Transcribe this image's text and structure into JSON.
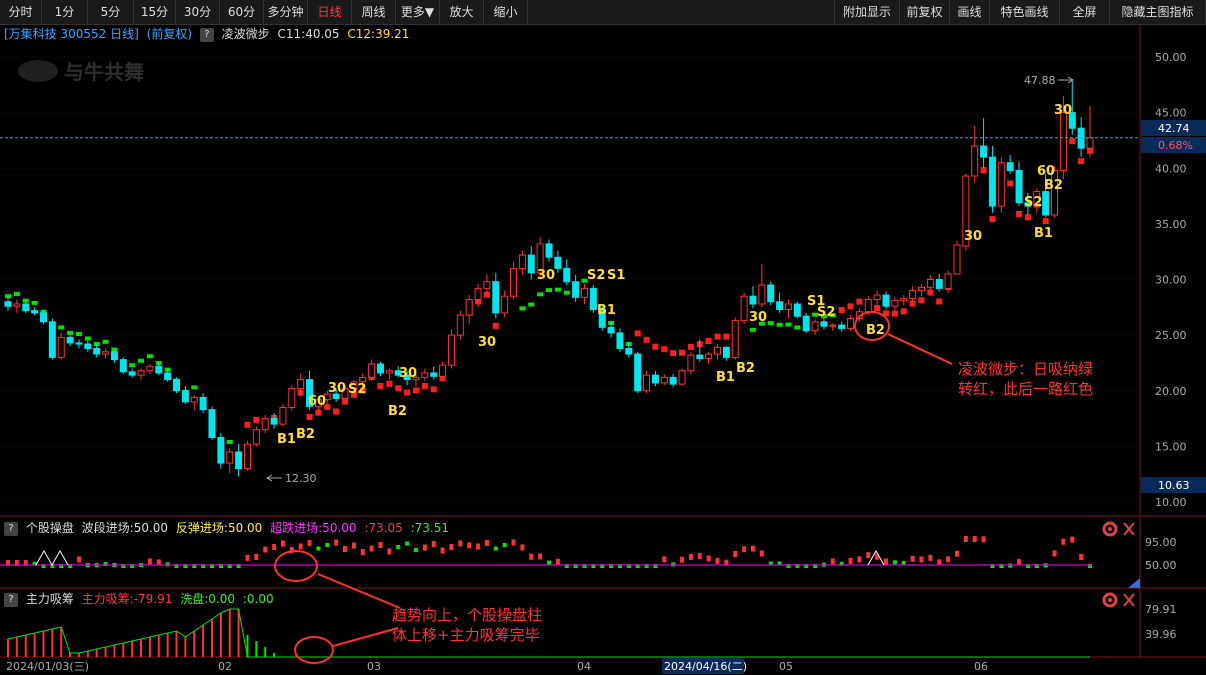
{
  "toolbar": {
    "left": [
      "分时",
      "1分",
      "5分",
      "15分",
      "30分",
      "60分",
      "多分钟",
      "日线",
      "周线",
      "更多▼",
      "放大",
      "缩小"
    ],
    "active": "日线",
    "right": [
      "附加显示",
      "前复权",
      "画线",
      "特色画线",
      "全屏",
      "隐藏主图指标"
    ]
  },
  "stock": {
    "title": "[万集科技 300552 日线]",
    "adjust": "(前复权)",
    "indicator": "凌波微步",
    "c1": "C11:40.05",
    "c2": "C12:39.21"
  },
  "watermark": "与牛共舞",
  "price_axis": {
    "labels": [
      "50.00",
      "45.00",
      "40.00",
      "35.00",
      "30.00",
      "25.00",
      "20.00",
      "15.00",
      "10.00"
    ],
    "current_price": "42.74",
    "change_pct": "0.68%",
    "bottom_price": "10.63"
  },
  "marks": {
    "high": "47.88",
    "low": "12.30"
  },
  "signal_labels": {
    "s30": "30",
    "s60": "60",
    "b1": "B1",
    "b2": "B2",
    "s1": "S1",
    "s2": "S2"
  },
  "annotations": {
    "main": [
      "凌波微步：日吸纳绿",
      "转红，此后一路红色"
    ],
    "sub": [
      "趋势向上，个股操盘柱",
      "体上移+主力吸筹完毕"
    ]
  },
  "panel1": {
    "name": "个股操盘",
    "p1": "波段进场:50.00",
    "p2": "反弹进场:50.00",
    "p3": "超跌进场:50.00",
    "p4": ":73.05",
    "p5": ":73.51",
    "axis": [
      "95.00",
      "50.00"
    ]
  },
  "panel2": {
    "name": "主力吸筹",
    "p1": "主力吸筹:-79.91",
    "p2": "洗盘:0.00",
    "p3": ":0.00",
    "axis": [
      "79.91",
      "39.96"
    ]
  },
  "date_axis": {
    "start": "2024/01/03(三)",
    "months": [
      "02",
      "03",
      "04",
      "05",
      "06"
    ],
    "cursor": "2024/04/16(二)"
  },
  "colors": {
    "up": "#ff3232",
    "down": "#00e5ee",
    "signal_text": "#ffdd33",
    "band_green": "#00e400",
    "band_red": "#ff1e1e",
    "annotation": "#ff3333"
  },
  "chart_data": {
    "type": "candlestick",
    "ylim": [
      9,
      52
    ],
    "current_price": 42.74,
    "candles_ohlc_approx": [
      [
        28.0,
        28.5,
        27.2,
        27.6
      ],
      [
        27.6,
        28.2,
        27.0,
        27.8
      ],
      [
        27.8,
        28.0,
        27.0,
        27.2
      ],
      [
        27.2,
        27.5,
        26.8,
        27.0
      ],
      [
        27.0,
        27.3,
        26.0,
        26.2
      ],
      [
        26.2,
        26.5,
        22.8,
        23.0
      ],
      [
        23.0,
        25.2,
        22.8,
        24.8
      ],
      [
        24.8,
        25.0,
        24.0,
        24.3
      ],
      [
        24.3,
        24.6,
        23.8,
        24.2
      ],
      [
        24.2,
        24.5,
        23.5,
        23.8
      ],
      [
        23.8,
        24.2,
        23.0,
        23.3
      ],
      [
        23.3,
        23.8,
        22.9,
        23.5
      ],
      [
        23.5,
        23.6,
        22.5,
        22.8
      ],
      [
        22.8,
        23.0,
        21.5,
        21.7
      ],
      [
        21.7,
        22.0,
        21.2,
        21.4
      ],
      [
        21.4,
        22.0,
        21.0,
        21.8
      ],
      [
        21.8,
        22.4,
        21.5,
        22.2
      ],
      [
        22.2,
        22.5,
        21.4,
        21.6
      ],
      [
        21.6,
        21.8,
        20.8,
        21.0
      ],
      [
        21.0,
        21.2,
        19.8,
        20.0
      ],
      [
        20.0,
        20.4,
        18.8,
        19.0
      ],
      [
        19.0,
        19.6,
        18.2,
        19.4
      ],
      [
        19.4,
        19.8,
        18.0,
        18.3
      ],
      [
        18.3,
        18.6,
        15.6,
        15.8
      ],
      [
        15.8,
        16.2,
        13.0,
        13.5
      ],
      [
        13.5,
        14.8,
        12.6,
        14.5
      ],
      [
        14.5,
        15.2,
        12.3,
        13.0
      ],
      [
        13.0,
        15.5,
        12.8,
        15.2
      ],
      [
        15.2,
        16.8,
        15.0,
        16.5
      ],
      [
        16.5,
        17.8,
        16.2,
        17.5
      ],
      [
        17.5,
        18.0,
        16.6,
        17.0
      ],
      [
        17.0,
        18.8,
        16.8,
        18.5
      ],
      [
        18.5,
        20.5,
        18.2,
        20.2
      ],
      [
        20.2,
        21.5,
        19.5,
        21.0
      ],
      [
        21.0,
        21.8,
        18.3,
        18.6
      ],
      [
        18.6,
        19.5,
        17.8,
        19.2
      ],
      [
        19.2,
        20.0,
        18.8,
        19.7
      ],
      [
        19.7,
        20.2,
        19.0,
        19.3
      ],
      [
        19.3,
        20.5,
        19.0,
        20.2
      ],
      [
        20.2,
        21.0,
        19.8,
        20.8
      ],
      [
        20.8,
        21.6,
        20.3,
        21.2
      ],
      [
        21.2,
        22.8,
        20.9,
        22.4
      ],
      [
        22.4,
        22.6,
        21.3,
        21.6
      ],
      [
        21.6,
        22.0,
        21.0,
        21.8
      ],
      [
        21.8,
        22.2,
        21.2,
        21.4
      ],
      [
        21.4,
        21.8,
        20.5,
        21.0
      ],
      [
        21.0,
        21.5,
        20.4,
        21.2
      ],
      [
        21.2,
        22.0,
        20.9,
        21.6
      ],
      [
        21.6,
        22.2,
        21.0,
        21.3
      ],
      [
        21.3,
        22.6,
        21.0,
        22.3
      ],
      [
        22.3,
        25.5,
        22.0,
        25.0
      ],
      [
        25.0,
        27.2,
        24.6,
        26.8
      ],
      [
        26.8,
        28.6,
        26.0,
        28.2
      ],
      [
        28.2,
        29.6,
        27.5,
        29.2
      ],
      [
        29.2,
        30.5,
        28.6,
        29.8
      ],
      [
        29.8,
        30.6,
        26.5,
        27.0
      ],
      [
        27.0,
        29.0,
        26.6,
        28.5
      ],
      [
        28.5,
        31.6,
        28.2,
        31.0
      ],
      [
        31.0,
        32.6,
        30.4,
        32.2
      ],
      [
        32.2,
        33.0,
        30.0,
        30.6
      ],
      [
        30.6,
        33.8,
        30.2,
        33.2
      ],
      [
        33.2,
        33.6,
        31.6,
        32.0
      ],
      [
        32.0,
        32.6,
        30.6,
        31.0
      ],
      [
        31.0,
        31.8,
        29.5,
        29.8
      ],
      [
        29.8,
        30.4,
        28.0,
        28.4
      ],
      [
        28.4,
        29.6,
        27.8,
        29.2
      ],
      [
        29.2,
        29.5,
        27.0,
        27.3
      ],
      [
        27.3,
        27.6,
        25.4,
        25.7
      ],
      [
        25.7,
        26.2,
        24.8,
        25.2
      ],
      [
        25.2,
        25.6,
        23.5,
        23.8
      ],
      [
        23.8,
        24.4,
        23.0,
        23.3
      ],
      [
        23.3,
        23.5,
        19.8,
        20.0
      ],
      [
        20.0,
        21.8,
        19.8,
        21.4
      ],
      [
        21.4,
        21.8,
        20.4,
        20.7
      ],
      [
        20.7,
        21.5,
        20.5,
        21.2
      ],
      [
        21.2,
        21.5,
        20.3,
        20.6
      ],
      [
        20.6,
        22.0,
        20.5,
        21.8
      ],
      [
        21.8,
        23.5,
        21.5,
        23.2
      ],
      [
        23.2,
        24.6,
        22.6,
        22.9
      ],
      [
        22.9,
        23.5,
        22.4,
        23.3
      ],
      [
        23.3,
        24.2,
        22.8,
        23.9
      ],
      [
        23.9,
        24.0,
        22.7,
        23.0
      ],
      [
        23.0,
        26.6,
        22.8,
        26.3
      ],
      [
        26.3,
        28.8,
        26.0,
        28.5
      ],
      [
        28.5,
        29.4,
        27.4,
        27.8
      ],
      [
        27.8,
        31.4,
        27.5,
        29.5
      ],
      [
        29.5,
        29.8,
        27.7,
        28.0
      ],
      [
        28.0,
        28.8,
        27.0,
        27.3
      ],
      [
        27.3,
        28.2,
        26.5,
        27.8
      ],
      [
        27.8,
        28.0,
        26.5,
        26.7
      ],
      [
        26.7,
        27.0,
        25.2,
        25.4
      ],
      [
        25.4,
        26.4,
        25.0,
        26.2
      ],
      [
        26.2,
        26.5,
        25.5,
        25.8
      ],
      [
        25.8,
        26.1,
        25.4,
        25.9
      ],
      [
        25.9,
        26.2,
        25.3,
        25.6
      ],
      [
        25.6,
        26.8,
        25.4,
        26.5
      ],
      [
        26.5,
        27.4,
        26.2,
        27.1
      ],
      [
        27.1,
        28.5,
        26.8,
        28.2
      ],
      [
        28.2,
        29.0,
        27.6,
        28.6
      ],
      [
        28.6,
        28.9,
        27.3,
        27.6
      ],
      [
        27.6,
        28.4,
        27.0,
        28.1
      ],
      [
        28.1,
        28.6,
        27.7,
        28.3
      ],
      [
        28.3,
        29.4,
        28.0,
        29.0
      ],
      [
        29.0,
        29.6,
        28.5,
        29.3
      ],
      [
        29.3,
        30.4,
        29.0,
        30.0
      ],
      [
        30.0,
        30.5,
        28.9,
        29.2
      ],
      [
        29.2,
        30.8,
        28.8,
        30.5
      ],
      [
        30.5,
        33.5,
        32.2,
        33.1
      ],
      [
        33.0,
        39.5,
        32.6,
        39.3
      ],
      [
        39.3,
        43.8,
        38.7,
        42.0
      ],
      [
        42.0,
        44.5,
        40.0,
        41.0
      ],
      [
        41.0,
        42.0,
        36.0,
        36.6
      ],
      [
        36.6,
        41.0,
        36.0,
        40.5
      ],
      [
        40.5,
        41.2,
        39.5,
        39.8
      ],
      [
        39.8,
        40.6,
        36.6,
        36.9
      ],
      [
        36.9,
        37.8,
        35.8,
        36.6
      ],
      [
        36.6,
        38.2,
        36.0,
        37.9
      ],
      [
        37.9,
        39.5,
        35.6,
        35.8
      ],
      [
        35.8,
        40.2,
        35.6,
        39.8
      ],
      [
        39.8,
        46.5,
        39.0,
        45.0
      ],
      [
        45.0,
        47.88,
        43.0,
        43.6
      ],
      [
        43.6,
        44.6,
        41.0,
        41.8
      ],
      [
        41.8,
        45.6,
        41.0,
        42.74
      ]
    ]
  }
}
